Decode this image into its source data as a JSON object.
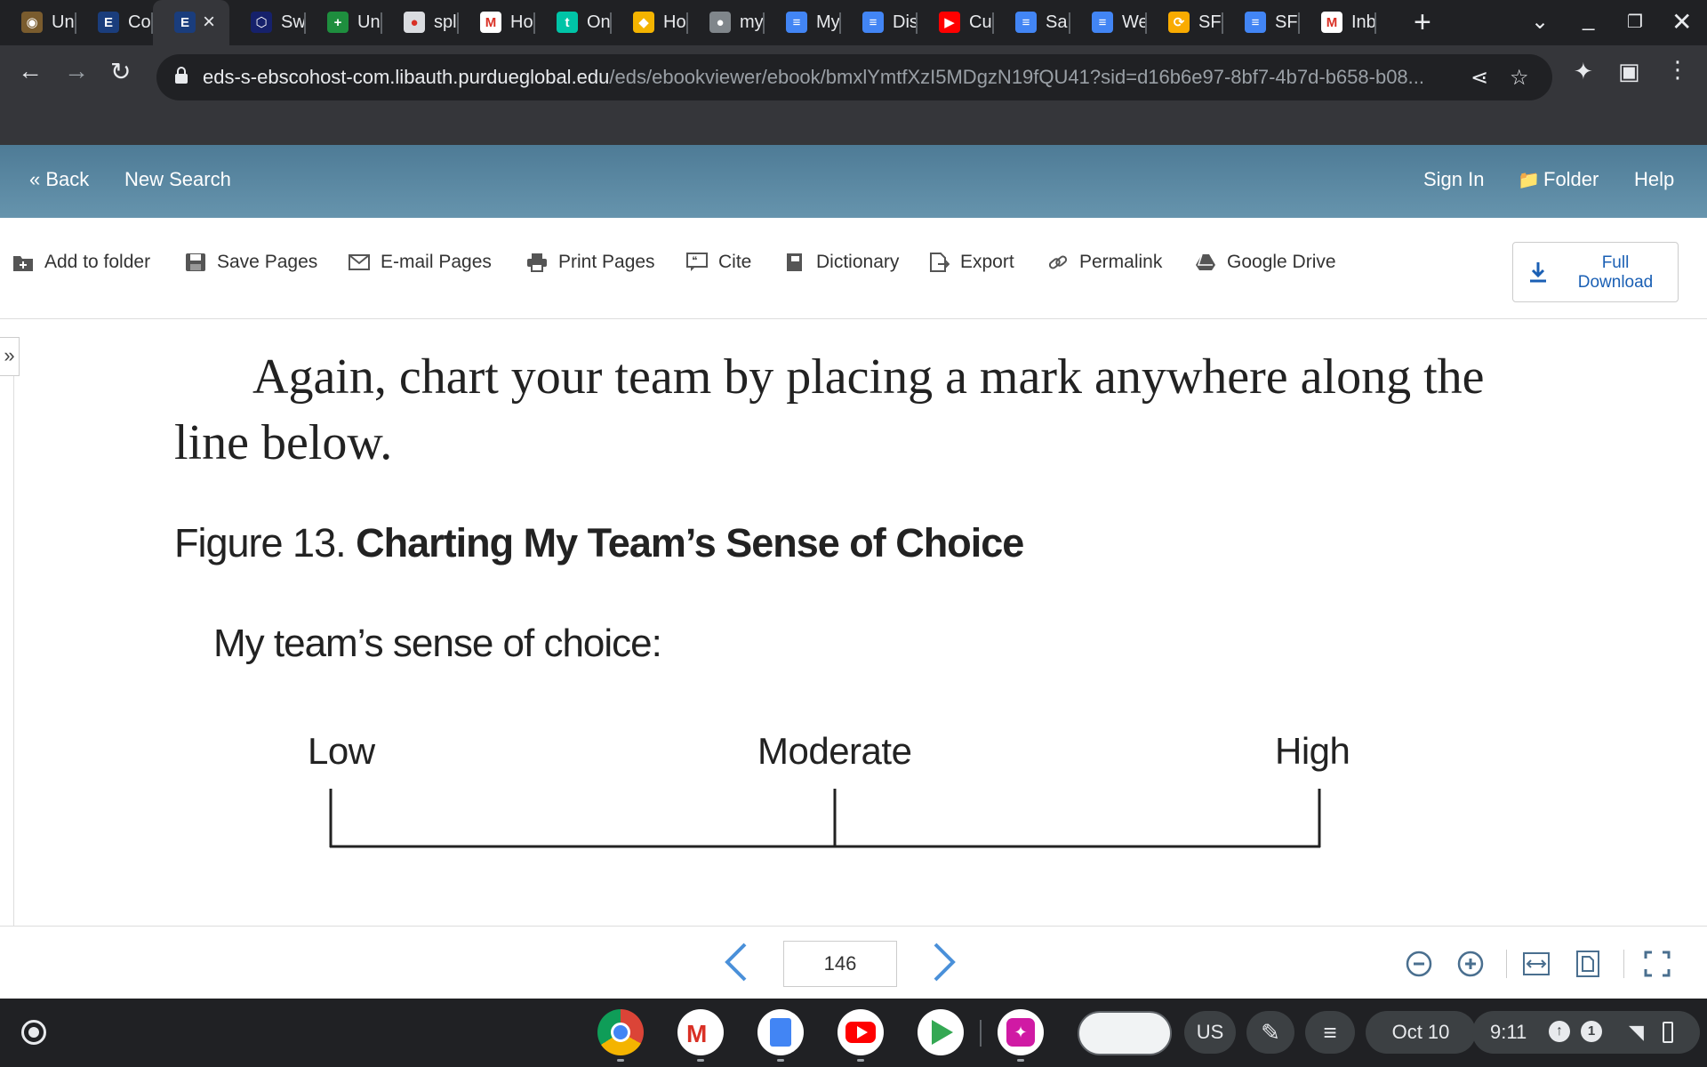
{
  "tabs": [
    {
      "title": "Uni",
      "color": "#7a5c2e",
      "glyph": "◉"
    },
    {
      "title": "Co",
      "color": "#1a3d7c",
      "glyph": "E"
    },
    {
      "title": "",
      "color": "#1a3d7c",
      "glyph": "E",
      "active": true
    },
    {
      "title": "Sw",
      "color": "#16216b",
      "glyph": "⬡"
    },
    {
      "title": "Un",
      "color": "#1e8e3e",
      "glyph": "+"
    },
    {
      "title": "spl",
      "color": "#dadce0",
      "glyph": "●"
    },
    {
      "title": "Ho",
      "color": "#ffffff",
      "glyph": "M"
    },
    {
      "title": "On",
      "color": "#00c4a7",
      "glyph": "t"
    },
    {
      "title": "Ho",
      "color": "#f4b400",
      "glyph": "◆"
    },
    {
      "title": "my",
      "color": "#80868b",
      "glyph": "●"
    },
    {
      "title": "My",
      "color": "#4285f4",
      "glyph": "≡"
    },
    {
      "title": "Dis",
      "color": "#4285f4",
      "glyph": "≡"
    },
    {
      "title": "Cu",
      "color": "#ff0000",
      "glyph": "▶"
    },
    {
      "title": "Sa",
      "color": "#4285f4",
      "glyph": "≡"
    },
    {
      "title": "We",
      "color": "#4285f4",
      "glyph": "≡"
    },
    {
      "title": "SF",
      "color": "#f9ab00",
      "glyph": "⟳"
    },
    {
      "title": "SF",
      "color": "#4285f4",
      "glyph": "≡"
    },
    {
      "title": "Inb",
      "color": "#ffffff",
      "glyph": "M"
    }
  ],
  "address": {
    "host": "eds-s-ebscohost-com.libauth.purdueglobal.edu",
    "path": "/eds/ebookviewer/ebook/bmxlYmtfXzI5MDgzN19fQU41?sid=d16b6e97-8bf7-4b7d-b658-b08..."
  },
  "header": {
    "back": "« Back",
    "new_search": "New Search",
    "sign_in": "Sign In",
    "folder": "Folder",
    "help": "Help"
  },
  "tools": {
    "add_to_folder": "Add to folder",
    "save_pages": "Save Pages",
    "email_pages": "E-mail Pages",
    "print_pages": "Print Pages",
    "cite": "Cite",
    "dictionary": "Dictionary",
    "export": "Export",
    "permalink": "Permalink",
    "google_drive": "Google Drive",
    "full_download_line1": "Full",
    "full_download_line2": "Download"
  },
  "page": {
    "sidebar_toggle": "»",
    "body_line1": "Again, chart your team by placing a mark anywhere along the",
    "body_line2": "line below.",
    "figure_label": "Figure 13.",
    "figure_title": "Charting My Team’s Sense of Choice",
    "choice_label": "My team’s sense of choice:",
    "scale_low": "Low",
    "scale_moderate": "Moderate",
    "scale_high": "High"
  },
  "pager": {
    "page_number": "146"
  },
  "shelf": {
    "keyboard": "US",
    "date": "Oct 10",
    "time": "9:11",
    "notification_count": "1"
  }
}
